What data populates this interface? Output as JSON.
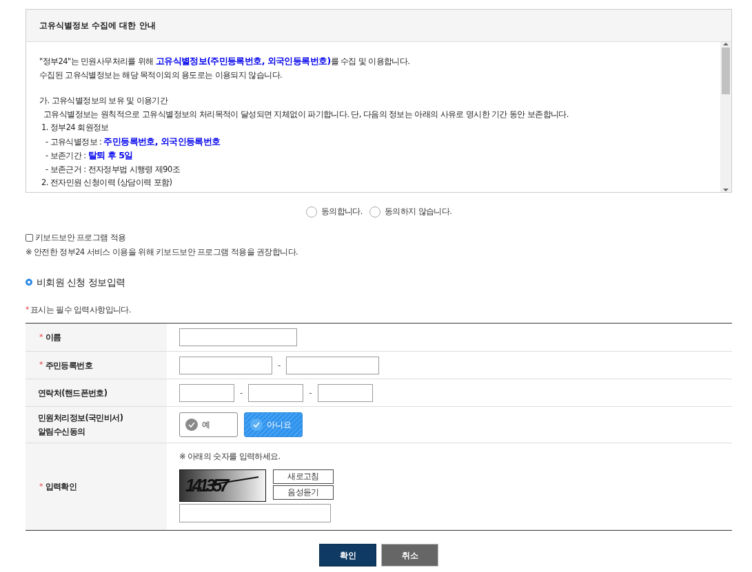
{
  "notice": {
    "title": "고유식별정보 수집에 대한 안내",
    "intro": [
      "\"정부24\"는 민원사무처리를 위해 **고유식별정보(주민등록번호, 외국인등록번호)**를 수집 및 이용합니다.",
      "수집된 고유식별정보는 해당 목적이외의 용도로는 이용되지 않습니다."
    ],
    "sections": [
      {
        "heading": "가. 고유식별정보의 보유 및 이용기간",
        "children": [
          {
            "text": "고유식별정보는 원칙적으로 고유식별정보의 처리목적이 달성되면 지체없이 파기합니다. 단, 다음의 정보는 아래의 사유로 명시한 기간 동안 보존합니다."
          },
          {
            "text": "1. 정부24 회원정보",
            "children": [
              {
                "text": "- 고유식별정보 : **주민등록번호, 외국인등록번호**"
              },
              {
                "text": "- 보존기간 : **탈퇴 후 5일**"
              },
              {
                "text": "- 보존근거 : 전자정부법 시행령 제90조"
              }
            ]
          },
          {
            "text": "2. 전자민원 신청이력 (상담이력 포함)"
          }
        ]
      }
    ]
  },
  "consent": [
    {
      "label": "동의합니다.",
      "selected": false
    },
    {
      "label": "동의하지 않습니다.",
      "selected": false
    }
  ],
  "keyboard_security": {
    "label": "키보드보안 프로그램 적용",
    "checked": false,
    "note": "※ 안전한 정부24 서비스 이용을 위해 키보드보안 프로그램 적용을 권장합니다."
  },
  "section_title": "비회원 신청 정보입력",
  "required_note": {
    "mark": "*",
    "text": "표시는 필수 입력사항입니다."
  },
  "form": [
    {
      "kind": "text",
      "label": "이름",
      "required": true
    },
    {
      "kind": "split2",
      "label": "주민등록번호",
      "required": true,
      "separator": "-"
    },
    {
      "kind": "split3",
      "label": "연락처(핸드폰번호)",
      "required": false,
      "separator": "-"
    },
    {
      "kind": "choice",
      "label": "민원처리정보(국민비서)\n알림수신동의",
      "required": false,
      "options": [
        {
          "label": "예",
          "selected": false
        },
        {
          "label": "아니요",
          "selected": true
        }
      ]
    },
    {
      "kind": "captcha",
      "label": "입력확인",
      "required": true,
      "hint": "※ 아래의 숫자를 입력하세요.",
      "code": "141357",
      "buttons": [
        "새로고침",
        "음성듣기"
      ]
    }
  ],
  "buttons": [
    {
      "label": "확인",
      "kind": "primary"
    },
    {
      "label": "취소",
      "kind": "secondary"
    }
  ]
}
